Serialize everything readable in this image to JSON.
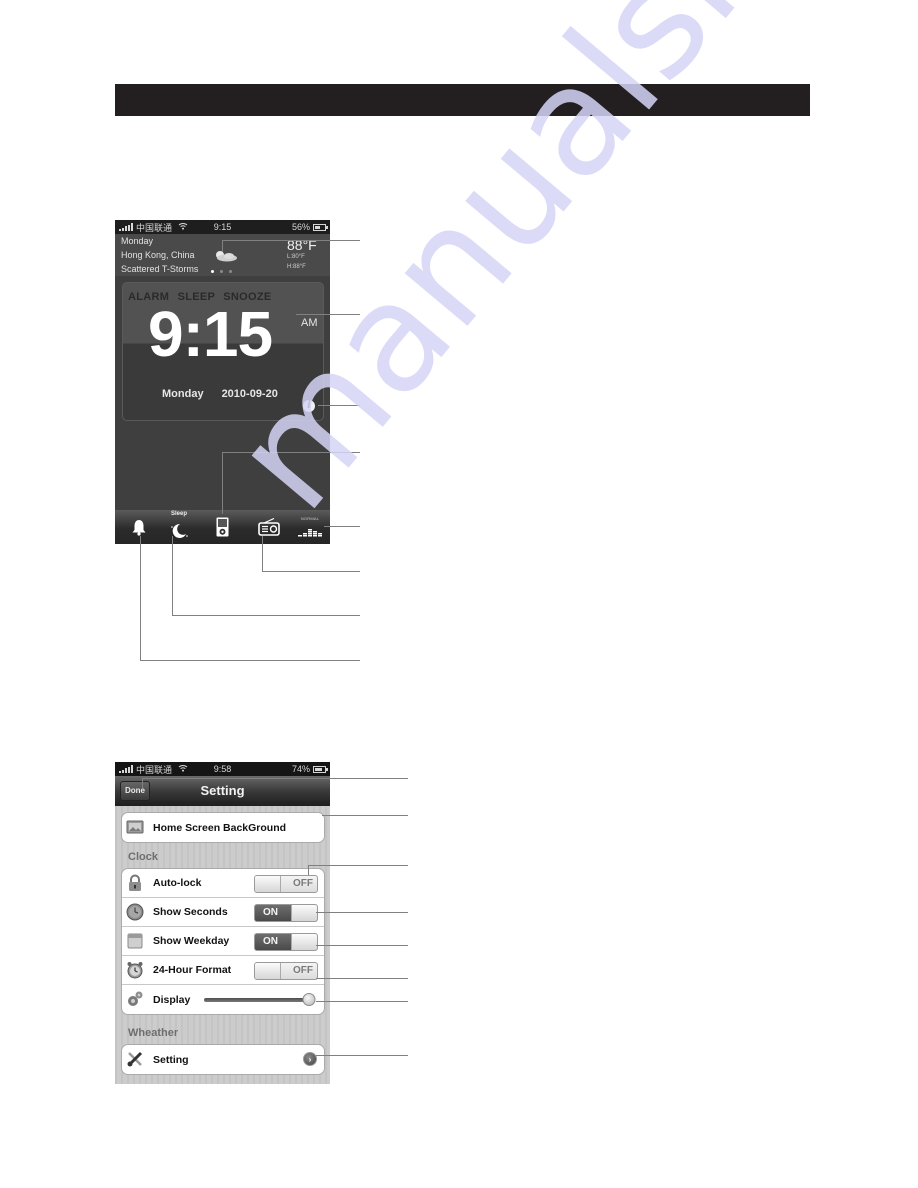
{
  "page": {
    "watermark": "manualshive"
  },
  "clock_screen": {
    "statusbar": {
      "carrier": "中国联通",
      "time": "9:15",
      "battery_label": "56%",
      "battery_level": 0.56
    },
    "weather": {
      "day": "Monday",
      "location": "Hong Kong, China",
      "condition": "Scattered T-Storms",
      "temperature": "88°F",
      "low": "L:80°F",
      "high": "H:88°F",
      "page_dots": 3,
      "active_dot": 0
    },
    "alarm_modes": "ALARM  SLEEP  SNOOZE",
    "time": "9:15",
    "ampm": "AM",
    "weekday": "Monday",
    "date": "2010-09-20",
    "info_glyph": "i",
    "tabbar": {
      "items": [
        {
          "name": "alarm",
          "icon": "bell-icon"
        },
        {
          "name": "sleep",
          "icon": "moon-icon",
          "label": "Sleep"
        },
        {
          "name": "music",
          "icon": "ipod-icon"
        },
        {
          "name": "radio",
          "icon": "radio-icon"
        },
        {
          "name": "equalizer",
          "icon": "equalizer-icon",
          "label": "NORMAL"
        }
      ]
    }
  },
  "settings_screen": {
    "statusbar": {
      "carrier": "中国联通",
      "time": "9:58",
      "battery_label": "74%",
      "battery_level": 0.74
    },
    "navbar": {
      "done_label": "Done",
      "title": "Setting"
    },
    "background_row": {
      "label": "Home Screen BackGround",
      "icon": "picture-icon"
    },
    "clock_section": {
      "title": "Clock",
      "rows": [
        {
          "label": "Auto-lock",
          "icon": "lock-icon",
          "type": "switch",
          "state": "OFF"
        },
        {
          "label": "Show Seconds",
          "icon": "clock-icon",
          "type": "switch",
          "state": "ON"
        },
        {
          "label": "Show Weekday",
          "icon": "calendar-icon",
          "type": "switch",
          "state": "ON"
        },
        {
          "label": "24-Hour Format",
          "icon": "alarm-clock-icon",
          "type": "switch",
          "state": "OFF"
        },
        {
          "label": "Display",
          "icon": "gears-icon",
          "type": "slider",
          "value": 0.95
        }
      ]
    },
    "weather_section": {
      "title": "Wheather",
      "rows": [
        {
          "label": "Setting",
          "icon": "tools-icon",
          "type": "disclosure",
          "glyph": "›"
        }
      ]
    }
  }
}
